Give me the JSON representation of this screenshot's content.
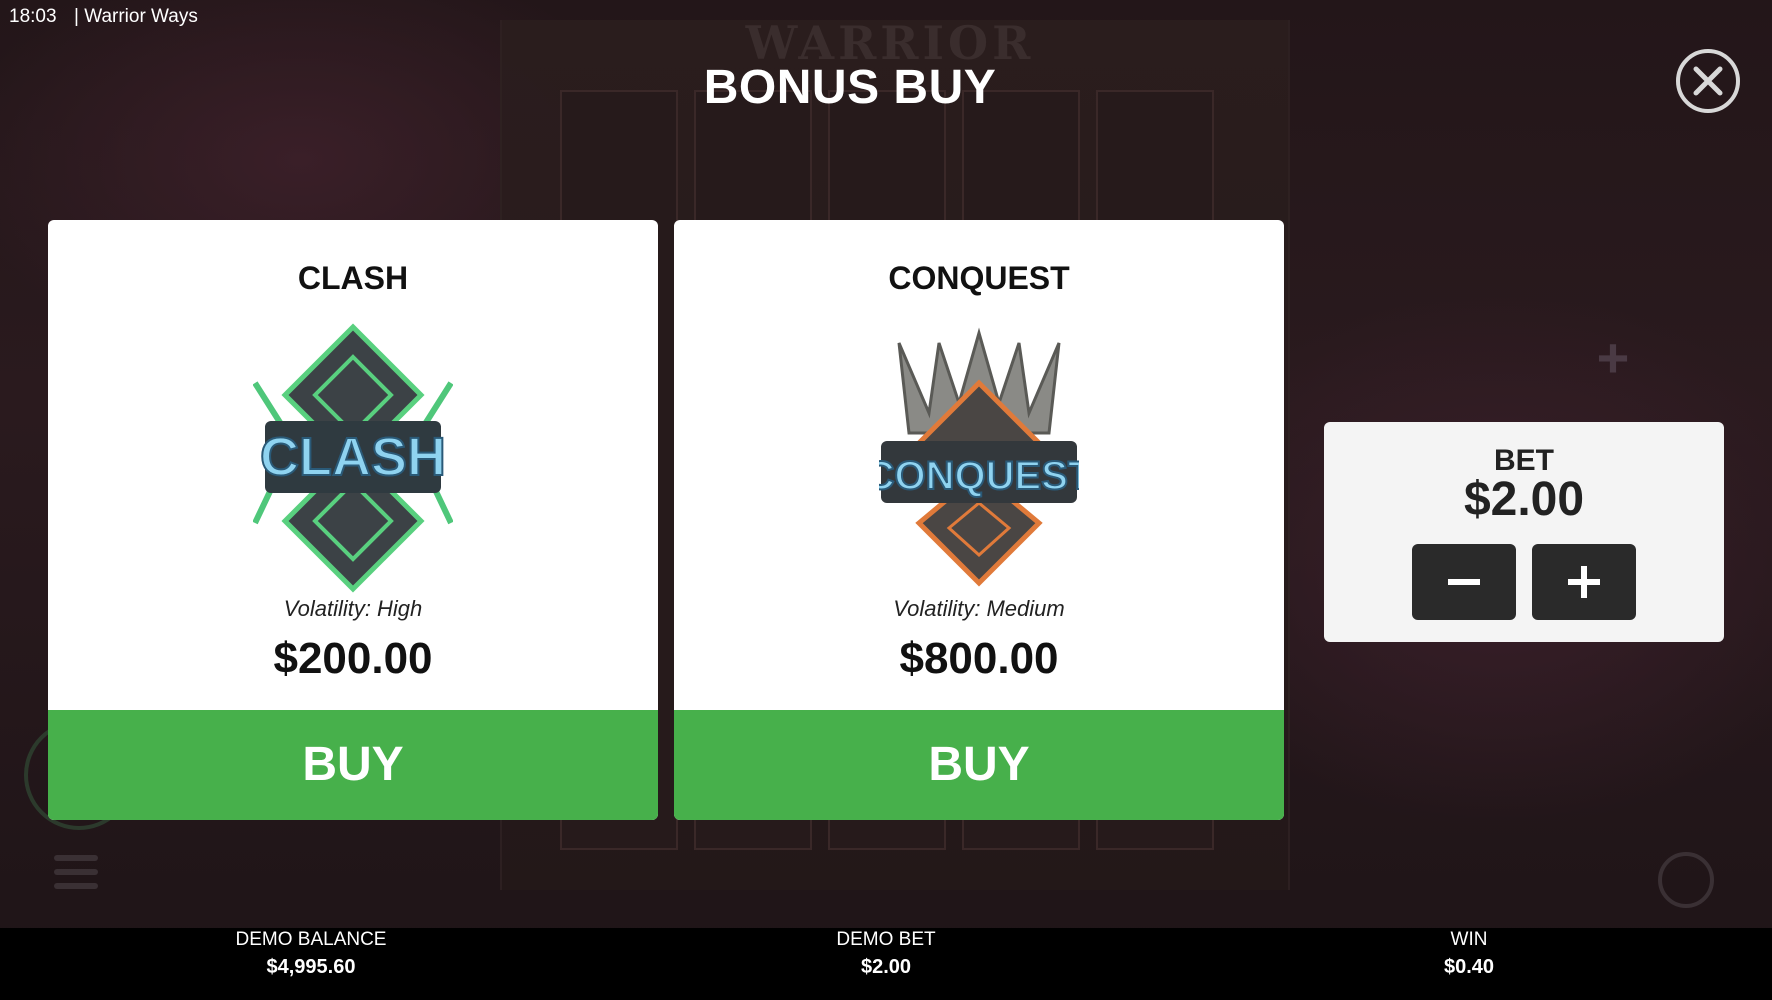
{
  "status": {
    "time": "18:03",
    "app_name": "| Warrior Ways"
  },
  "background": {
    "game_title": "WARRIOR"
  },
  "dialog": {
    "title": "BONUS BUY",
    "close_icon": "close-icon",
    "cards": [
      {
        "name": "CLASH",
        "emblem_text": "CLASH",
        "volatility_prefix": "Volatility:",
        "volatility": "High",
        "price": "$200.00",
        "buy_label": "BUY",
        "emblem_color": "#5fd38a"
      },
      {
        "name": "CONQUEST",
        "emblem_text": "CONQUEST",
        "volatility_prefix": "Volatility:",
        "volatility": "Medium",
        "price": "$800.00",
        "buy_label": "BUY",
        "emblem_color": "#e07a3a"
      }
    ],
    "bet_panel": {
      "label": "BET",
      "value": "$2.00",
      "minus_icon": "minus-icon",
      "plus_icon": "plus-icon"
    }
  },
  "bottom_bar": {
    "balance_label": "DEMO BALANCE",
    "balance_value": "$4,995.60",
    "bet_label": "DEMO BET",
    "bet_value": "$2.00",
    "win_label": "WIN",
    "win_value": "$0.40"
  },
  "colors": {
    "buy_green": "#47b04b",
    "step_dark": "#2a2a2a"
  }
}
